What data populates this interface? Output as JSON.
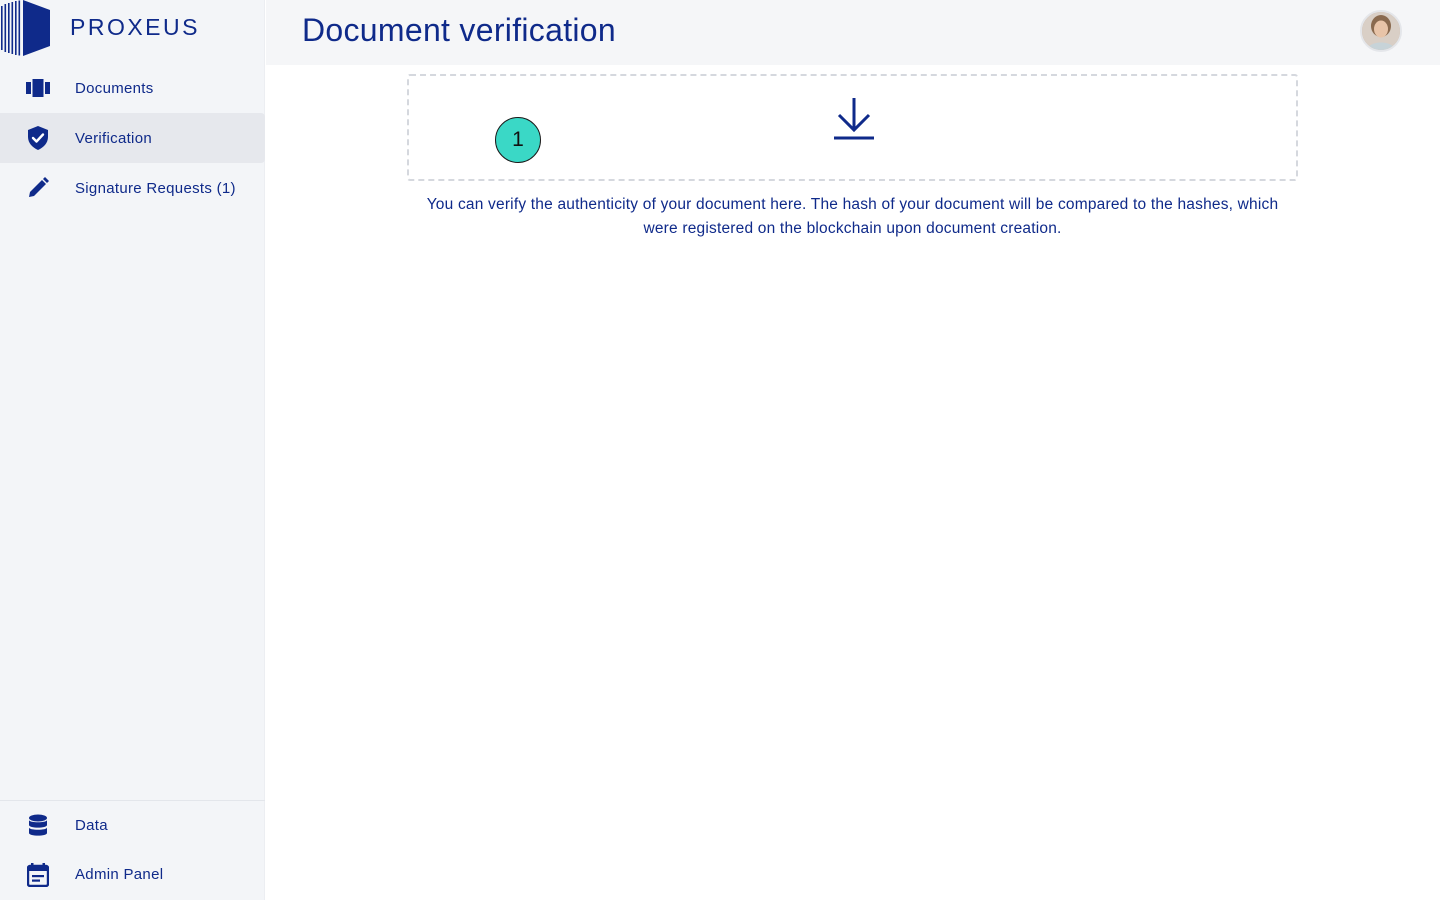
{
  "app": {
    "brand_name": "PROXEUS",
    "accent_color": "#0f2a8a",
    "badge_color": "#3ad8c6"
  },
  "sidebar": {
    "items": [
      {
        "label": "Documents",
        "icon": "documents-icon",
        "active": false
      },
      {
        "label": "Verification",
        "icon": "shield-check-icon",
        "active": true
      },
      {
        "label": "Signature Requests (1)",
        "icon": "pen-icon",
        "active": false
      }
    ],
    "bottom_items": [
      {
        "label": "Data",
        "icon": "database-icon"
      },
      {
        "label": "Admin Panel",
        "icon": "calendar-icon"
      }
    ]
  },
  "header": {
    "title": "Document verification",
    "avatar": "user-avatar"
  },
  "main": {
    "dropzone": {
      "icon": "download-icon",
      "step_badge": "1"
    },
    "info_text": "You can verify the authenticity of your document here. The hash of your document will be compared to the hashes, which were registered on the blockchain upon document creation."
  }
}
